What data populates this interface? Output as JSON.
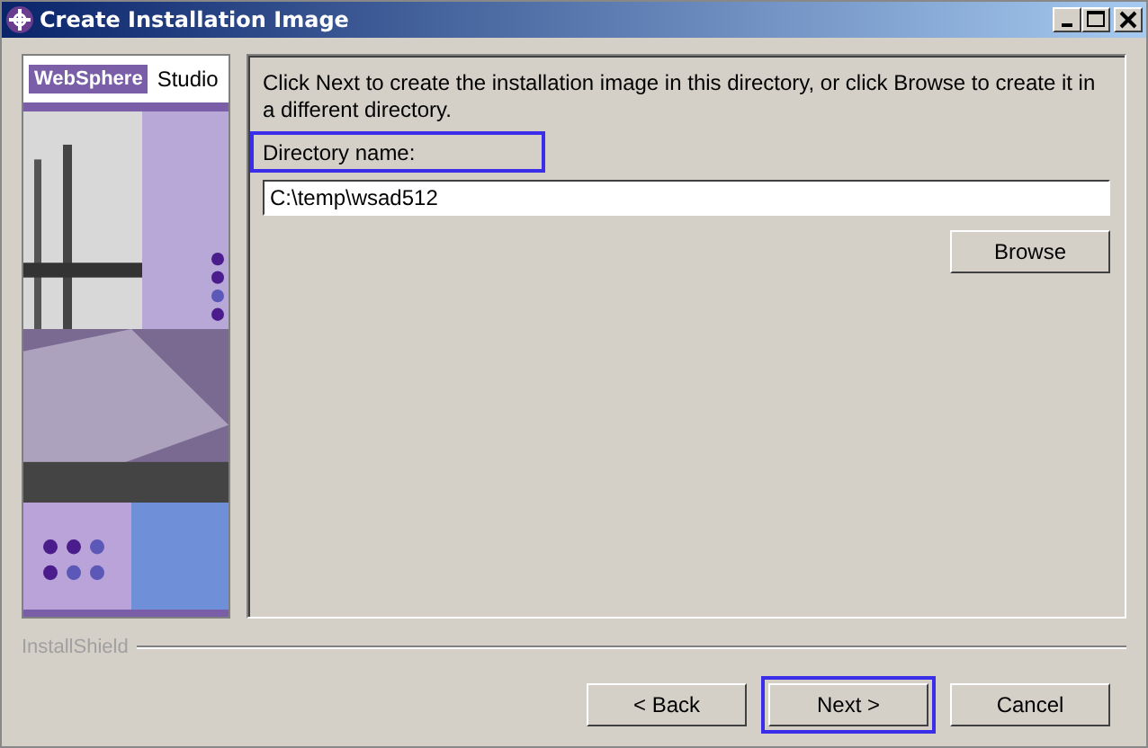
{
  "window": {
    "title": "Create Installation Image"
  },
  "logo": {
    "brand": "WebSphere",
    "product": "Studio"
  },
  "instructions": "Click Next to create the installation image in this directory, or click Browse to create it in a different directory.",
  "directory": {
    "label": "Directory name:",
    "value": "C:\\temp\\wsad512",
    "highlighted": true
  },
  "browse_button": {
    "label": "Browse",
    "highlighted": false
  },
  "footer": {
    "brand": "InstallShield"
  },
  "buttons": [
    {
      "label": "< Back",
      "highlighted": false
    },
    {
      "label": "Next >",
      "highlighted": true
    },
    {
      "label": "Cancel",
      "highlighted": false
    }
  ]
}
